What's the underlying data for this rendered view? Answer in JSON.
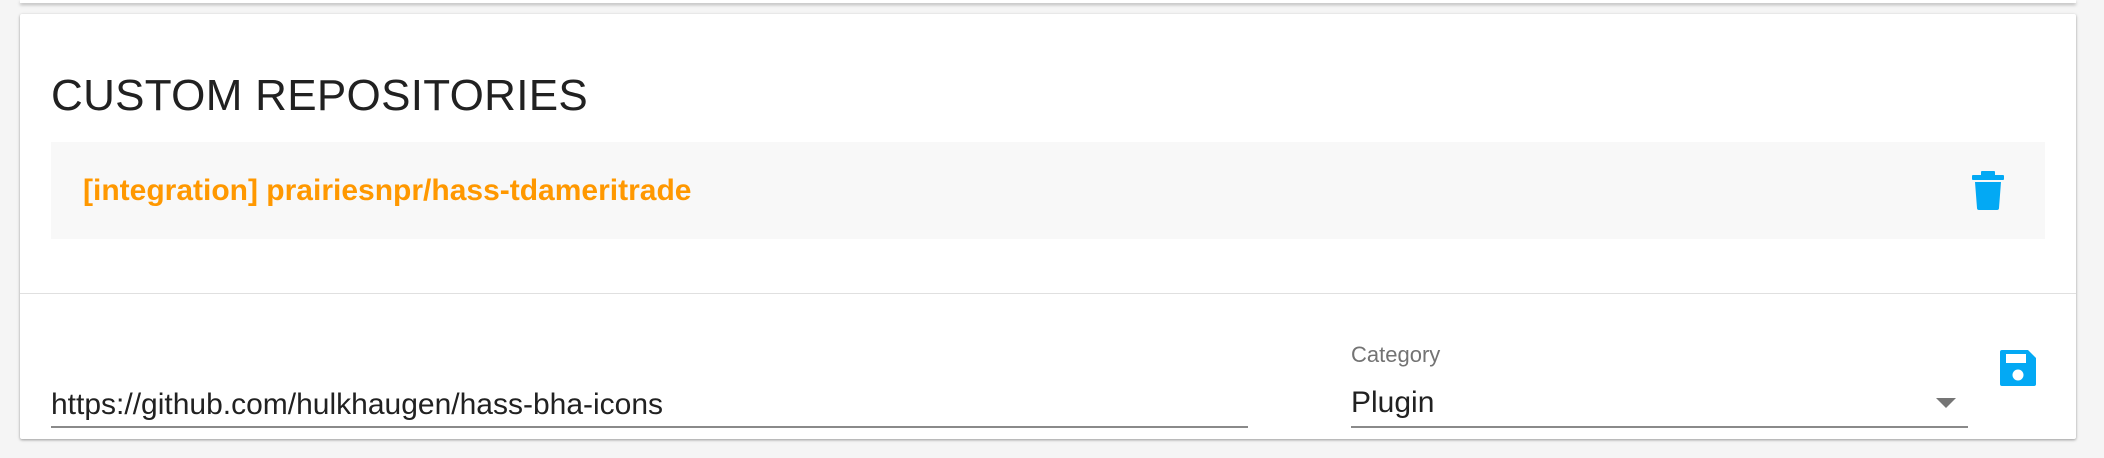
{
  "colors": {
    "accent": "#03a9f4",
    "repo_label": "#ff9800"
  },
  "section": {
    "title": "CUSTOM REPOSITORIES"
  },
  "repositories": [
    {
      "label": "[integration] prairiesnpr/hass-tdameritrade",
      "action_icon": "trash-icon"
    }
  ],
  "add_form": {
    "url_value": "https://github.com/hulkhaugen/hass-bha-icons",
    "category_label": "Category",
    "category_value": "Plugin",
    "save_icon": "save-icon"
  }
}
